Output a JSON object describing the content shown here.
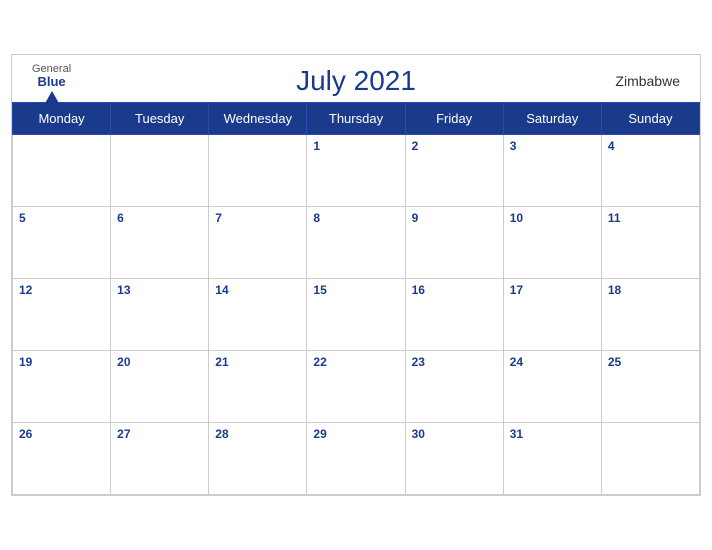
{
  "header": {
    "logo_general": "General",
    "logo_blue": "Blue",
    "month_year": "July 2021",
    "country": "Zimbabwe"
  },
  "weekdays": [
    "Monday",
    "Tuesday",
    "Wednesday",
    "Thursday",
    "Friday",
    "Saturday",
    "Sunday"
  ],
  "weeks": [
    [
      null,
      null,
      null,
      1,
      2,
      3,
      4
    ],
    [
      5,
      6,
      7,
      8,
      9,
      10,
      11
    ],
    [
      12,
      13,
      14,
      15,
      16,
      17,
      18
    ],
    [
      19,
      20,
      21,
      22,
      23,
      24,
      25
    ],
    [
      26,
      27,
      28,
      29,
      30,
      31,
      null
    ]
  ]
}
